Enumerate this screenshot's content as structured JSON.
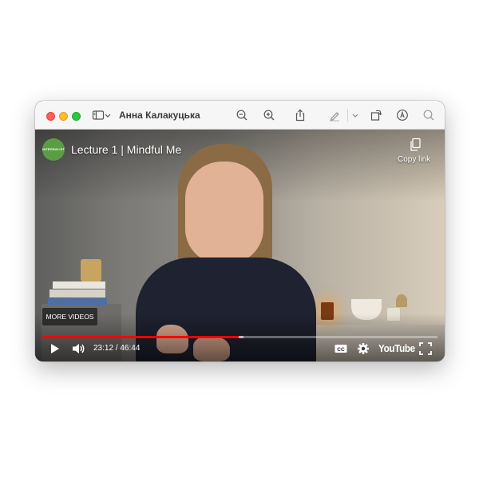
{
  "window": {
    "title": "Анна Калакуцька"
  },
  "toolbar": {
    "icons": [
      "sidebar-toggle-icon",
      "chevron-down-icon",
      "zoom-out-icon",
      "zoom-in-icon",
      "share-icon",
      "highlight-pen-icon",
      "chevron-down-icon",
      "rotate-icon",
      "markup-icon",
      "search-icon"
    ]
  },
  "video": {
    "channel_logo_text": "INTEGRALIST",
    "title": "Lecture 1 | Mindful Me",
    "copy_link_label": "Copy link",
    "more_videos_label": "MORE VIDEOS",
    "time_display": "23:12 / 46:44",
    "progress_played_fraction": 0.4966,
    "progress_loaded_fraction": 0.51,
    "youtube_label": "YouTube"
  },
  "colors": {
    "close": "#fe5f57",
    "minimize": "#febc2e",
    "maximize": "#28c840",
    "progress": "#ff0000",
    "channel_logo": "#5a9d45"
  }
}
